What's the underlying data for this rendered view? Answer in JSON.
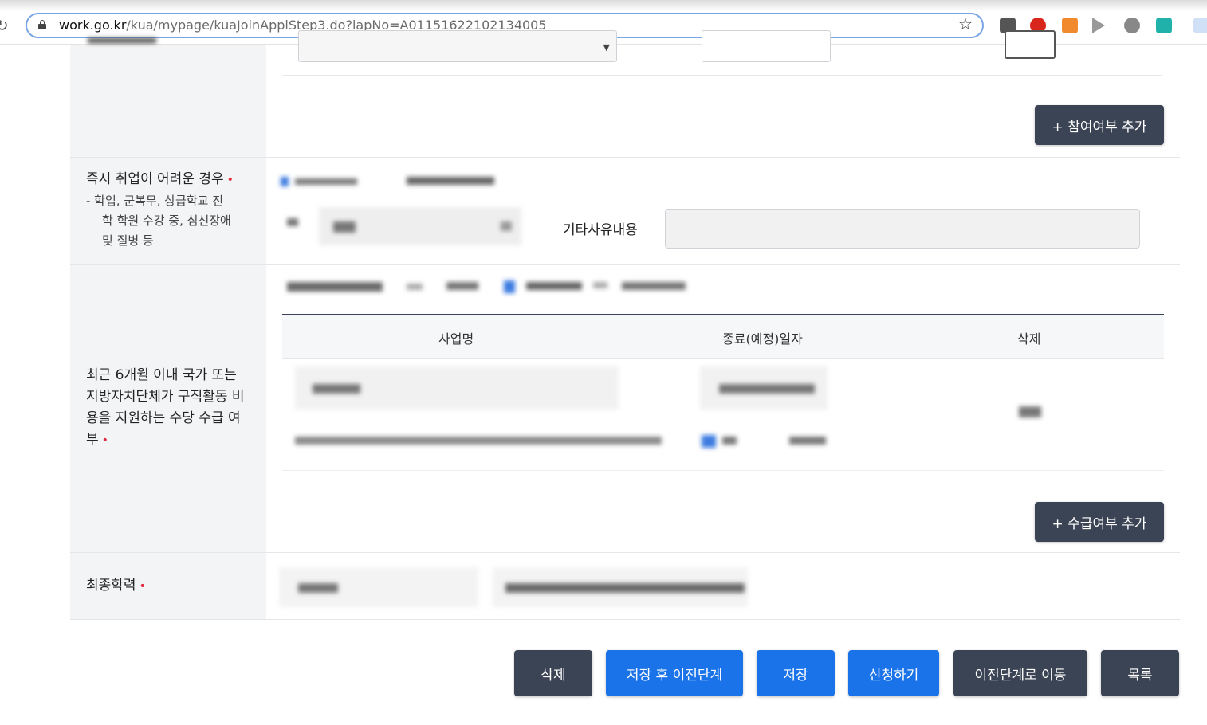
{
  "browser": {
    "url_host": "work.go.kr",
    "url_path": "/kua/mypage/kuaJoinApplStep3.do?iapNo=A01151622102134005"
  },
  "form": {
    "participation_add_button": "+ 참여여부 추가",
    "difficult_employment": {
      "label": "즉시 취업이 어려운 경우",
      "sub_line1": "- 학업, 군복무, 상급학교 진",
      "sub_line2": "학 학원 수강 중, 심신장애",
      "sub_line3": "및 질병 등",
      "other_reason_label": "기타사유내용",
      "other_reason_value": ""
    },
    "allowance": {
      "label_line1": "최근 6개월 이내 국가 또는",
      "label_line2": "지방자치단체가 구직활동 비",
      "label_line3": "용을 지원하는 수당 수급 여",
      "label_line4": "부",
      "columns": [
        "사업명",
        "종료(예정)일자",
        "삭제"
      ],
      "add_button": "+ 수급여부 추가"
    },
    "education": {
      "label": "최종학력"
    },
    "required_marker": "•"
  },
  "actions": {
    "delete": "삭제",
    "save_prev": "저장 후 이전단계",
    "save": "저장",
    "apply": "신청하기",
    "go_prev": "이전단계로 이동",
    "list": "목록"
  },
  "colors": {
    "dark_button": "#3b4454",
    "blue_button": "#1a73e8",
    "header_bg": "#f3f4f6",
    "required": "#e2283a"
  }
}
